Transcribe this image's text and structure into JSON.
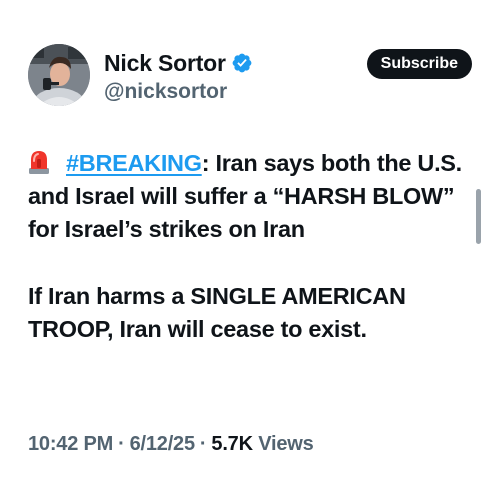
{
  "author": {
    "display_name": "Nick Sortor",
    "handle": "@nicksortor",
    "avatar_icon": "profile-photo-avatar",
    "verified_icon": "verified-badge-icon",
    "verified_color": "#1d9bf0"
  },
  "actions": {
    "subscribe_label": "Subscribe"
  },
  "tweet": {
    "emoji_icon": "siren-emoji-icon",
    "hashtag": "#BREAKING",
    "line1_rest": ": Iran says both the U.S. and Israel will suffer a “HARSH BLOW” for Israel’s strikes on Iran",
    "paragraph2": "If Iran harms a SINGLE AMERICAN TROOP, Iran will cease to exist."
  },
  "meta": {
    "time": "10:42 PM",
    "date": "6/12/25",
    "separator": "·",
    "views_count": "5.7K",
    "views_label": "Views"
  },
  "colors": {
    "text": "#0f1419",
    "secondary": "#536471",
    "link": "#1d9bf0",
    "button_bg": "#0f1419"
  }
}
